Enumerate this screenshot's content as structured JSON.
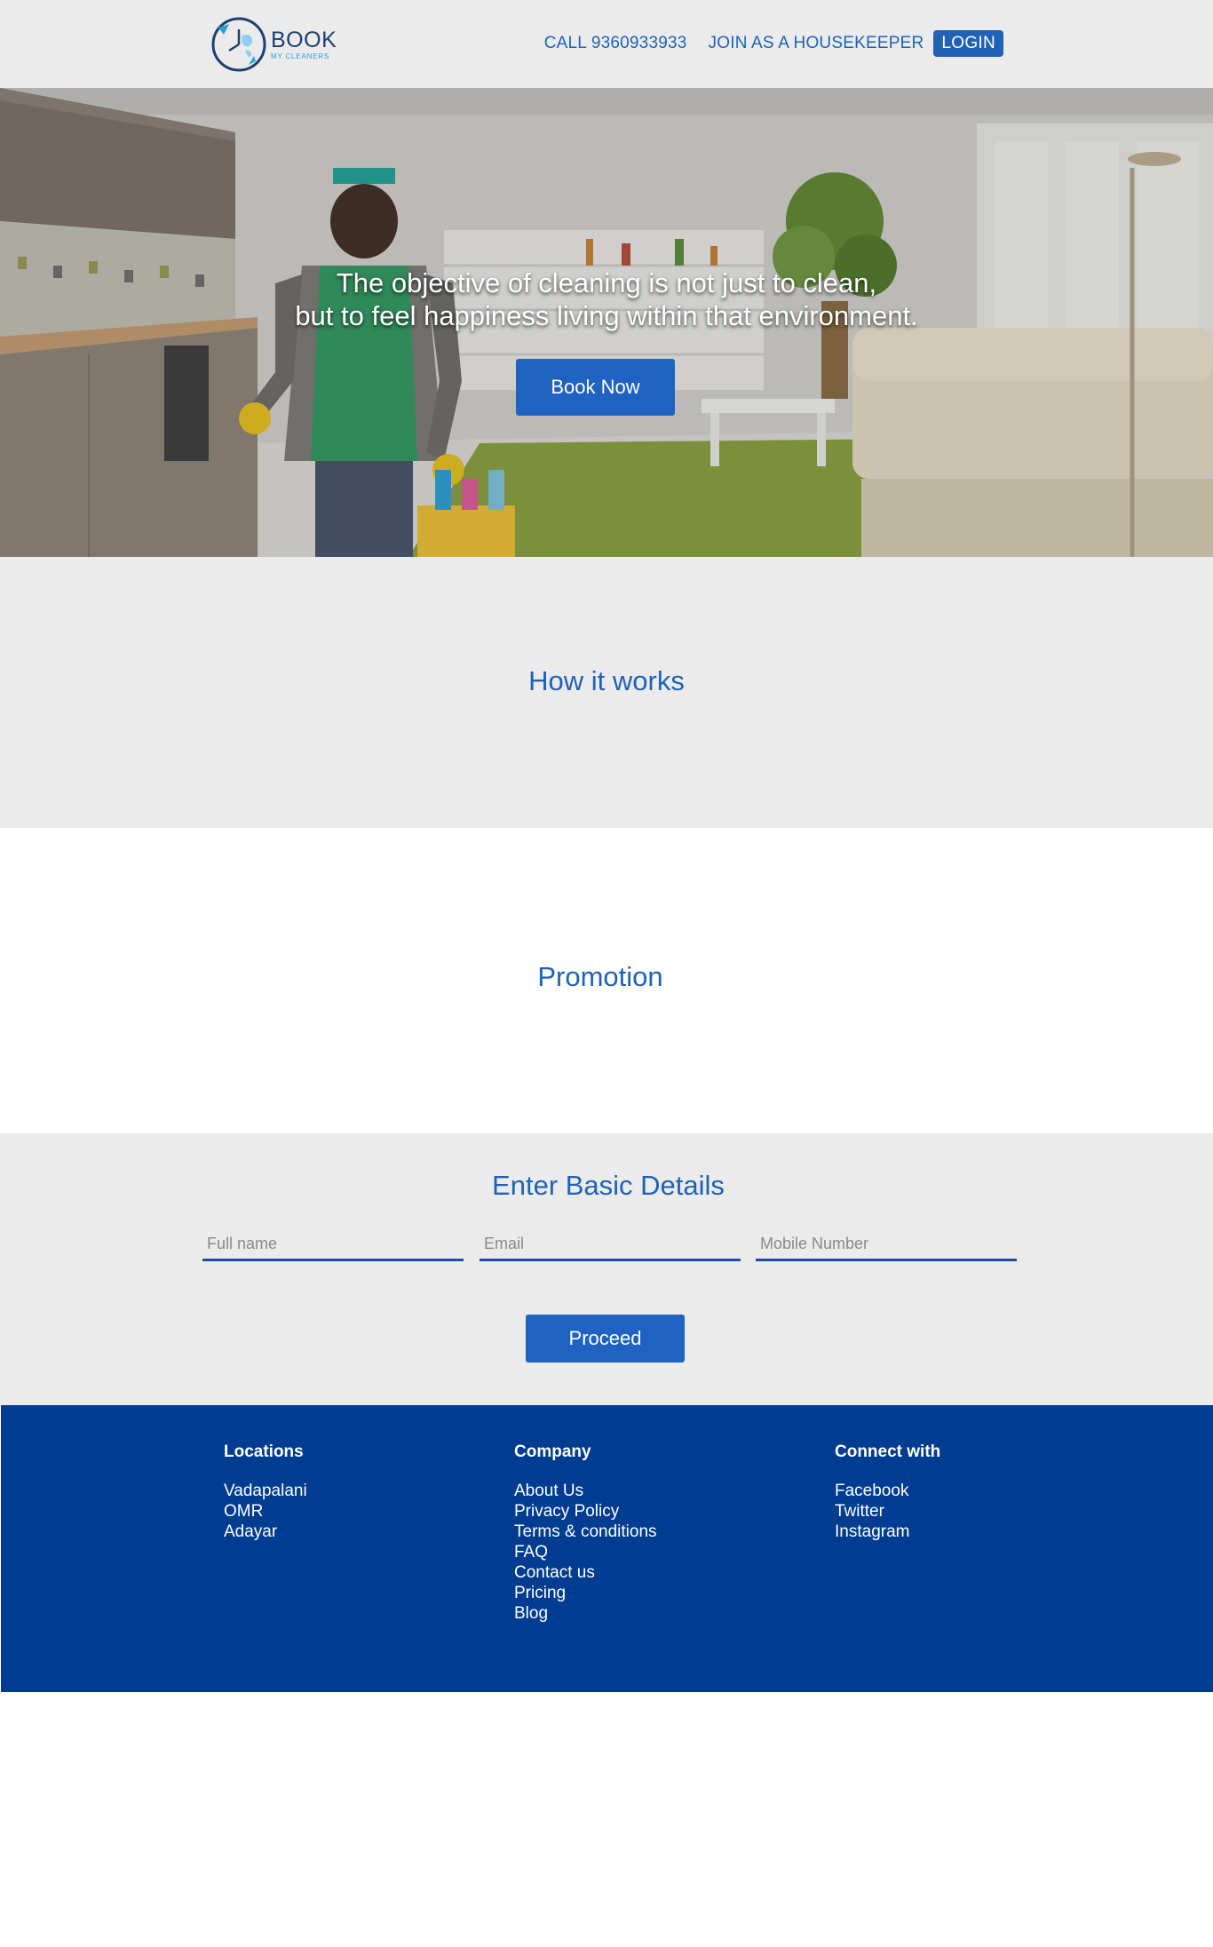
{
  "header": {
    "logo_main": "BOOK",
    "logo_sub": "MY CLEANERS",
    "call_label": "CALL 9360933933",
    "join_label": "JOIN AS A HOUSEKEEPER",
    "login_label": "LOGIN"
  },
  "hero": {
    "quote_line1": "The objective of cleaning is not just to clean,",
    "quote_line2": "but to feel happiness living within that environment.",
    "book_button": "Book Now"
  },
  "how_it_works": {
    "title": "How it works"
  },
  "promotion": {
    "title": "Promotion"
  },
  "basic_details": {
    "title": "Enter Basic Details",
    "full_name_placeholder": "Full name",
    "email_placeholder": "Email",
    "mobile_placeholder": "Mobile Number",
    "proceed_button": "Proceed"
  },
  "footer": {
    "locations": {
      "heading": "Locations",
      "items": [
        "Vadapalani",
        "OMR",
        "Adayar"
      ]
    },
    "company": {
      "heading": "Company",
      "items": [
        "About Us",
        "Privacy Policy",
        "Terms & conditions",
        "FAQ",
        "Contact us",
        "Pricing",
        "Blog"
      ]
    },
    "connect": {
      "heading": "Connect with",
      "items": [
        "Facebook",
        "Twitter",
        "Instagram"
      ]
    }
  },
  "colors": {
    "brand_blue": "#1f62b6",
    "button_blue": "#1f62c1",
    "footer_blue": "#003c8f",
    "section_gray": "#ebebeb"
  }
}
